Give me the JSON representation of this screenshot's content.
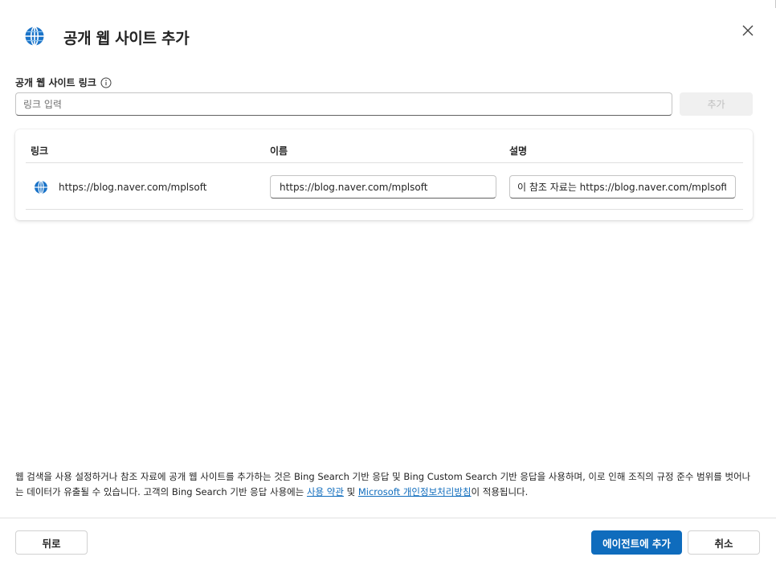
{
  "dialog": {
    "title": "공개 웹 사이트 추가",
    "close_icon": "close-icon",
    "header_icon": "globe-icon"
  },
  "link_field": {
    "label": "공개 웹 사이트 링크",
    "info_icon": "info-icon",
    "placeholder": "링크 입력",
    "value": "",
    "add_button": "추가"
  },
  "table": {
    "columns": [
      "링크",
      "이름",
      "설명"
    ],
    "rows": [
      {
        "icon": "globe-icon",
        "link": "https://blog.naver.com/mplsoft",
        "name": "https://blog.naver.com/mplsoft",
        "description": "이 참조 자료는 https://blog.naver.com/mplsoft"
      }
    ]
  },
  "disclaimer": {
    "text_before": "웹 검색을 사용 설정하거나 참조 자료에 공개 웹 사이트를 추가하는 것은 Bing Search 기반 응답 및 Bing Custom Search 기반 응답을 사용하며, 이로 인해 조직의 규정 준수 범위를 벗어나는 데이터가 유출될 수 있습니다. 고객의 Bing Search 기반 응답 사용에는 ",
    "terms_link": "사용 약관",
    "text_middle": " 및 ",
    "privacy_link": "Microsoft 개인정보처리방침",
    "text_after": "이 적용됩니다."
  },
  "footer": {
    "back_button": "뒤로",
    "primary_button": "에이전트에 추가",
    "cancel_button": "취소"
  },
  "colors": {
    "accent": "#0f6cbd",
    "link": "#0f6cbd",
    "disabled_bg": "#f0f0f0",
    "disabled_text": "#bdbdbd"
  }
}
